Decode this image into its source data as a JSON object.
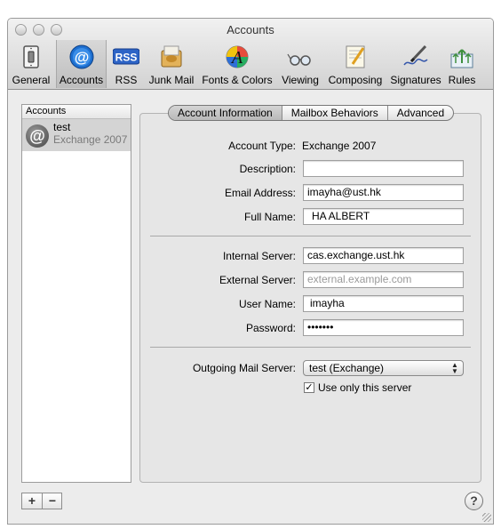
{
  "window": {
    "title": "Accounts"
  },
  "toolbar": {
    "items": [
      {
        "label": "General",
        "icon": "light-switch-icon"
      },
      {
        "label": "Accounts",
        "icon": "at-sign-icon",
        "selected": true
      },
      {
        "label": "RSS",
        "icon": "rss-badge-icon"
      },
      {
        "label": "Junk Mail",
        "icon": "junk-mail-icon"
      },
      {
        "label": "Fonts & Colors",
        "icon": "fonts-colors-icon"
      },
      {
        "label": "Viewing",
        "icon": "glasses-icon"
      },
      {
        "label": "Composing",
        "icon": "pencil-paper-icon"
      },
      {
        "label": "Signatures",
        "icon": "signature-pen-icon"
      },
      {
        "label": "Rules",
        "icon": "rules-arrows-icon"
      }
    ],
    "rss_badge": "RSS",
    "at_symbol": "@"
  },
  "sidebar": {
    "header": "Accounts",
    "accounts": [
      {
        "name": "test",
        "type": "Exchange 2007"
      }
    ]
  },
  "tabs": [
    {
      "label": "Account Information",
      "active": true
    },
    {
      "label": "Mailbox Behaviors",
      "active": false
    },
    {
      "label": "Advanced",
      "active": false
    }
  ],
  "form": {
    "account_type": {
      "label": "Account Type:",
      "value": "Exchange 2007"
    },
    "description": {
      "label": "Description:",
      "value": ""
    },
    "email": {
      "label": "Email Address:",
      "value": "imayha@ust.hk"
    },
    "full_name": {
      "label": "Full Name:",
      "value": "HA ALBERT"
    },
    "internal_server": {
      "label": "Internal Server:",
      "value": "cas.exchange.ust.hk"
    },
    "external_server": {
      "label": "External Server:",
      "value": "",
      "placeholder": "external.example.com"
    },
    "user_name": {
      "label": "User Name:",
      "value": "imayha"
    },
    "password": {
      "label": "Password:",
      "value": "•••••••"
    },
    "outgoing": {
      "label": "Outgoing Mail Server:",
      "value": "test (Exchange)"
    },
    "use_only": {
      "label": "Use only this server",
      "checked": true
    }
  },
  "bottom": {
    "add": "+",
    "remove": "−",
    "help": "?"
  }
}
